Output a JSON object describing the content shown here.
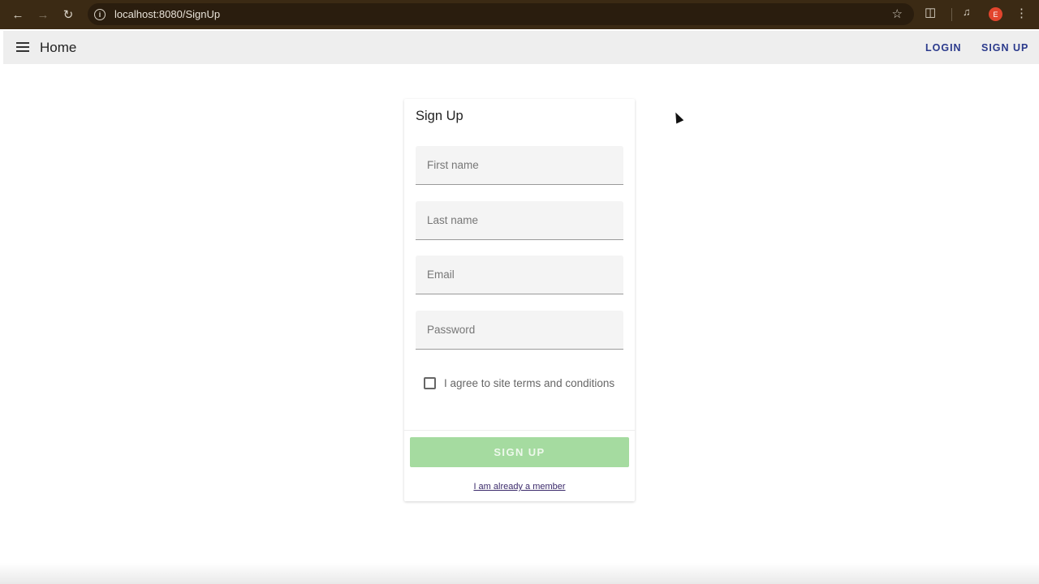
{
  "browser": {
    "url": "localhost:8080/SignUp",
    "profile_initial": "E",
    "icons": [
      "back-arrow-icon",
      "forward-arrow-icon",
      "reload-icon",
      "info-icon",
      "star-icon",
      "extensions-icon",
      "media-icon",
      "more-vert-icon"
    ]
  },
  "appbar": {
    "title": "Home",
    "login": "LOGIN",
    "signup": "SIGN UP"
  },
  "form": {
    "title": "Sign Up",
    "first_name_placeholder": "First name",
    "last_name_placeholder": "Last name",
    "email_placeholder": "Email",
    "password_placeholder": "Password",
    "agree_label": "I agree to site terms and conditions",
    "submit_label": "SIGN UP",
    "member_link": "I am already a member"
  },
  "colors": {
    "chrome": "#3b2a14",
    "appbar_bg": "#eeeeee",
    "nav_link": "#2b3a8c",
    "submit_disabled": "#a5dba0"
  }
}
